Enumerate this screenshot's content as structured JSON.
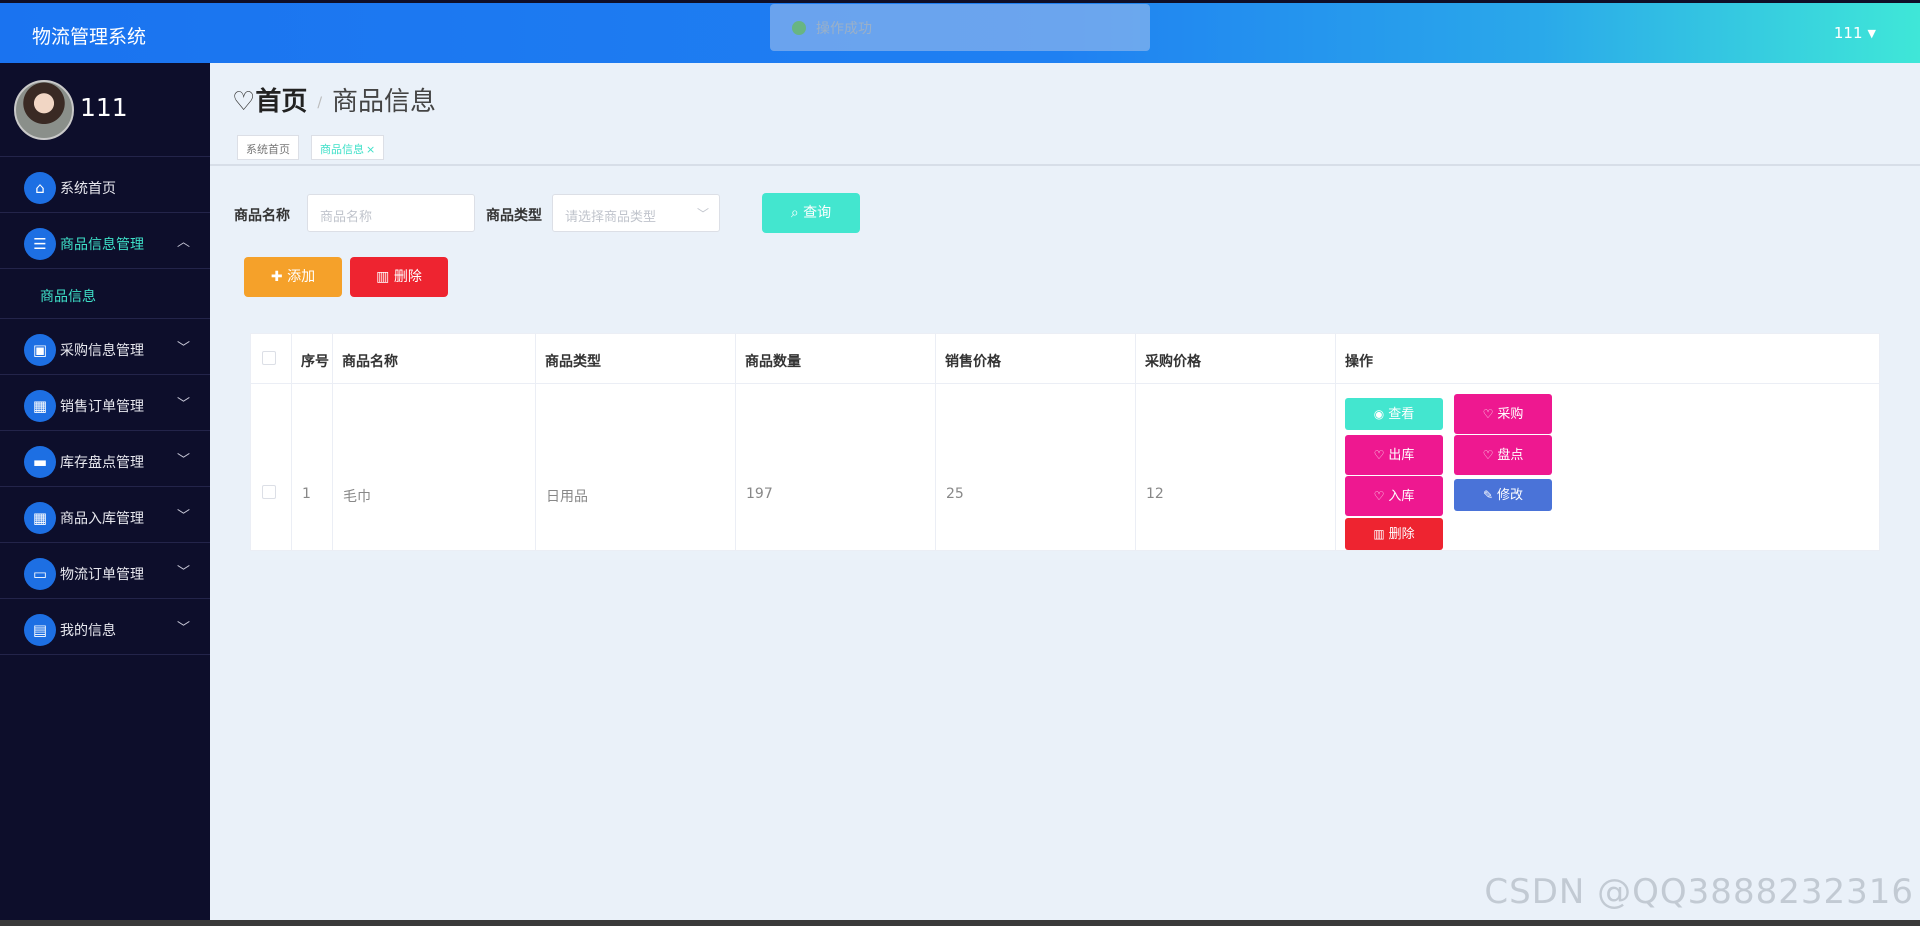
{
  "header": {
    "app_title": "物流管理系统",
    "user": "111"
  },
  "toast": {
    "message": "操作成功"
  },
  "sidebar": {
    "profile_name": "111",
    "menu": [
      {
        "label": "系统首页",
        "icon": "home-icon"
      },
      {
        "label": "商品信息管理",
        "icon": "list-icon",
        "open": true,
        "children": [
          {
            "label": "商品信息"
          }
        ]
      },
      {
        "label": "采购信息管理",
        "icon": "clipboard-icon"
      },
      {
        "label": "销售订单管理",
        "icon": "grid-icon"
      },
      {
        "label": "库存盘点管理",
        "icon": "ticket-icon"
      },
      {
        "label": "商品入库管理",
        "icon": "apps-icon"
      },
      {
        "label": "物流订单管理",
        "icon": "monitor-icon"
      },
      {
        "label": "我的信息",
        "icon": "card-icon"
      }
    ]
  },
  "page": {
    "breadcrumb_home": "首页",
    "breadcrumb_sep": "/",
    "breadcrumb_current": "商品信息",
    "tabs": [
      {
        "label": "系统首页"
      },
      {
        "label": "商品信息",
        "active": true
      }
    ]
  },
  "search": {
    "name_label": "商品名称",
    "name_placeholder": "商品名称",
    "type_label": "商品类型",
    "type_placeholder": "请选择商品类型",
    "search_button": "查询"
  },
  "actions": {
    "add": "添加",
    "delete": "删除"
  },
  "table": {
    "columns": [
      "序号",
      "商品名称",
      "商品类型",
      "商品数量",
      "销售价格",
      "采购价格",
      "操作"
    ],
    "rows": [
      {
        "index": "1",
        "name": "毛巾",
        "type": "日用品",
        "quantity": "197",
        "sale_price": "25",
        "purchase_price": "12"
      }
    ],
    "row_ops": [
      "查看",
      "采购",
      "出库",
      "盘点",
      "入库",
      "修改",
      "删除"
    ]
  },
  "colors": {
    "header_start": "#1a73f0",
    "header_end": "#3fe7d8",
    "accent": "#3ee0c8",
    "sidebar": "#0d0e2b",
    "add": "#f5a12a",
    "danger": "#ee2430",
    "pink": "#ee1890",
    "edit": "#4a73d8"
  },
  "watermark": "CSDN @QQ3888232316"
}
